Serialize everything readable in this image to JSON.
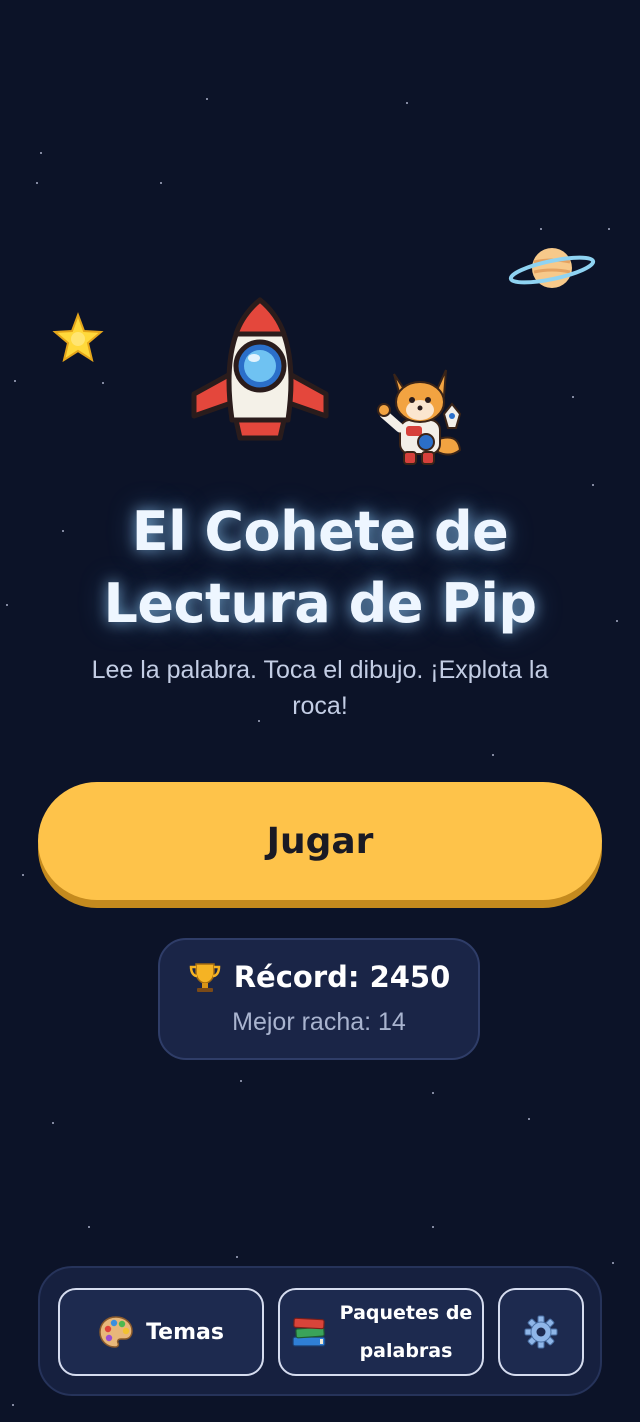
{
  "title": {
    "line1": "El Cohete de",
    "line2": "Lectura de Pip"
  },
  "subtitle": {
    "line1": "Lee la palabra. Toca el dibujo. ¡Explota la",
    "line2": "roca!"
  },
  "play_label": "Jugar",
  "record": {
    "icon": "trophy-icon",
    "label": "Récord: 2450",
    "streak": "Mejor racha: 14"
  },
  "bottom_nav": {
    "themes": {
      "icon": "palette-icon",
      "label": "Temas"
    },
    "packs": {
      "icon": "books-icon",
      "line1": "Paquetes de",
      "line2": "palabras"
    },
    "settings": {
      "icon": "gear-icon"
    }
  },
  "colors": {
    "background": "#0c1328",
    "play_button": "#fec34a",
    "card": "#1a2547",
    "title_glow": "#96d2ff"
  }
}
